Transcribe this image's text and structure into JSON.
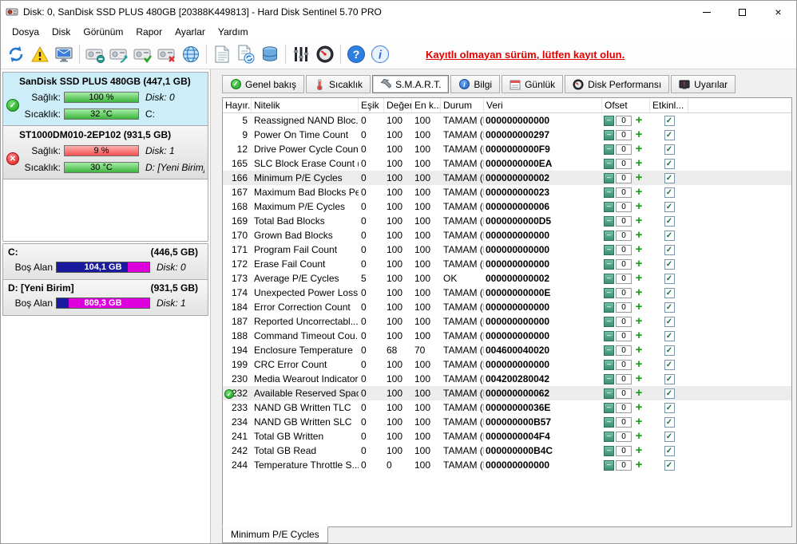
{
  "window": {
    "title": "Disk: 0, SanDisk SSD PLUS 480GB [20388K449813]  -  Hard Disk Sentinel 5.70 PRO"
  },
  "menu": {
    "items": [
      "Dosya",
      "Disk",
      "Görünüm",
      "Rapor",
      "Ayarlar",
      "Yardım"
    ]
  },
  "toolbar": {
    "register_link": "Kayıtlı olmayan sürüm, lütfen kayıt olun."
  },
  "sidebar": {
    "disks": [
      {
        "name": "SanDisk SSD PLUS 480GB",
        "size": "(447,1 GB)",
        "health_label": "Sağlık:",
        "health_value": "100 %",
        "health_pct": 100,
        "disk_no": "Disk: 0",
        "temp_label": "Sıcaklık:",
        "temp_value": "32 °C",
        "drive_letter": "C:"
      },
      {
        "name": "ST1000DM010-2EP102",
        "size": "(931,5 GB)",
        "health_label": "Sağlık:",
        "health_value": "9 %",
        "health_pct": 9,
        "disk_no": "Disk: 1",
        "temp_label": "Sıcaklık:",
        "temp_value": "30 °C",
        "drive_letter": "D: [Yeni Birim]"
      }
    ],
    "partitions": [
      {
        "name": "C:",
        "size": "(446,5 GB)",
        "free_label": "Boş Alan",
        "free_value": "104,1 GB",
        "free_pct": 23,
        "disk_no": "Disk: 0"
      },
      {
        "name": "D: [Yeni Birim]",
        "size": "(931,5 GB)",
        "free_label": "Boş Alan",
        "free_value": "809,3 GB",
        "free_pct": 87,
        "disk_no": "Disk: 1"
      }
    ]
  },
  "tabs": [
    {
      "label": "Genel bakış"
    },
    {
      "label": "Sıcaklık"
    },
    {
      "label": "S.M.A.R.T."
    },
    {
      "label": "Bilgi"
    },
    {
      "label": "Günlük"
    },
    {
      "label": "Disk Performansı"
    },
    {
      "label": "Uyarılar"
    }
  ],
  "smart_table": {
    "headers": [
      "Hayır.",
      "Nitelik",
      "Eşik",
      "Değer",
      "En k...",
      "Durum",
      "Veri",
      "Ofset",
      "Etkinl..."
    ],
    "rows": [
      {
        "id": "5",
        "attribute": "Reassigned NAND Bloc...",
        "threshold": "0",
        "value": "100",
        "worst": "100",
        "status": "TAMAM (H...",
        "data": "000000000000",
        "offset": "0",
        "enabled": true,
        "selected": false,
        "ok_icon": false
      },
      {
        "id": "9",
        "attribute": "Power On Time Count",
        "threshold": "0",
        "value": "100",
        "worst": "100",
        "status": "TAMAM (H...",
        "data": "000000000297",
        "offset": "0",
        "enabled": true,
        "selected": false,
        "ok_icon": false
      },
      {
        "id": "12",
        "attribute": "Drive Power Cycle Count",
        "threshold": "0",
        "value": "100",
        "worst": "100",
        "status": "TAMAM (H...",
        "data": "0000000000F9",
        "offset": "0",
        "enabled": true,
        "selected": false,
        "ok_icon": false
      },
      {
        "id": "165",
        "attribute": "SLC Block Erase Count (...",
        "threshold": "0",
        "value": "100",
        "worst": "100",
        "status": "TAMAM (H...",
        "data": "0000000000EA",
        "offset": "0",
        "enabled": true,
        "selected": false,
        "ok_icon": false
      },
      {
        "id": "166",
        "attribute": "Minimum P/E Cycles",
        "threshold": "0",
        "value": "100",
        "worst": "100",
        "status": "TAMAM (H...",
        "data": "000000000002",
        "offset": "0",
        "enabled": true,
        "selected": true,
        "ok_icon": false
      },
      {
        "id": "167",
        "attribute": "Maximum Bad Blocks Pe...",
        "threshold": "0",
        "value": "100",
        "worst": "100",
        "status": "TAMAM (H...",
        "data": "000000000023",
        "offset": "0",
        "enabled": true,
        "selected": false,
        "ok_icon": false
      },
      {
        "id": "168",
        "attribute": "Maximum P/E Cycles",
        "threshold": "0",
        "value": "100",
        "worst": "100",
        "status": "TAMAM (H...",
        "data": "000000000006",
        "offset": "0",
        "enabled": true,
        "selected": false,
        "ok_icon": false
      },
      {
        "id": "169",
        "attribute": "Total Bad Blocks",
        "threshold": "0",
        "value": "100",
        "worst": "100",
        "status": "TAMAM (H...",
        "data": "0000000000D5",
        "offset": "0",
        "enabled": true,
        "selected": false,
        "ok_icon": false
      },
      {
        "id": "170",
        "attribute": "Grown Bad Blocks",
        "threshold": "0",
        "value": "100",
        "worst": "100",
        "status": "TAMAM (H...",
        "data": "000000000000",
        "offset": "0",
        "enabled": true,
        "selected": false,
        "ok_icon": false
      },
      {
        "id": "171",
        "attribute": "Program Fail Count",
        "threshold": "0",
        "value": "100",
        "worst": "100",
        "status": "TAMAM (H...",
        "data": "000000000000",
        "offset": "0",
        "enabled": true,
        "selected": false,
        "ok_icon": false
      },
      {
        "id": "172",
        "attribute": "Erase Fail Count",
        "threshold": "0",
        "value": "100",
        "worst": "100",
        "status": "TAMAM (H...",
        "data": "000000000000",
        "offset": "0",
        "enabled": true,
        "selected": false,
        "ok_icon": false
      },
      {
        "id": "173",
        "attribute": "Average P/E Cycles",
        "threshold": "5",
        "value": "100",
        "worst": "100",
        "status": "OK",
        "data": "000000000002",
        "offset": "0",
        "enabled": true,
        "selected": false,
        "ok_icon": false
      },
      {
        "id": "174",
        "attribute": "Unexpected Power Loss...",
        "threshold": "0",
        "value": "100",
        "worst": "100",
        "status": "TAMAM (H...",
        "data": "00000000000E",
        "offset": "0",
        "enabled": true,
        "selected": false,
        "ok_icon": false
      },
      {
        "id": "184",
        "attribute": "Error Correction Count",
        "threshold": "0",
        "value": "100",
        "worst": "100",
        "status": "TAMAM (H...",
        "data": "000000000000",
        "offset": "0",
        "enabled": true,
        "selected": false,
        "ok_icon": false
      },
      {
        "id": "187",
        "attribute": "Reported Uncorrectabl...",
        "threshold": "0",
        "value": "100",
        "worst": "100",
        "status": "TAMAM (H...",
        "data": "000000000000",
        "offset": "0",
        "enabled": true,
        "selected": false,
        "ok_icon": false
      },
      {
        "id": "188",
        "attribute": "Command Timeout Cou...",
        "threshold": "0",
        "value": "100",
        "worst": "100",
        "status": "TAMAM (H...",
        "data": "000000000000",
        "offset": "0",
        "enabled": true,
        "selected": false,
        "ok_icon": false
      },
      {
        "id": "194",
        "attribute": "Enclosure Temperature",
        "threshold": "0",
        "value": "68",
        "worst": "70",
        "status": "TAMAM (H...",
        "data": "004600040020",
        "offset": "0",
        "enabled": true,
        "selected": false,
        "ok_icon": false
      },
      {
        "id": "199",
        "attribute": "CRC Error Count",
        "threshold": "0",
        "value": "100",
        "worst": "100",
        "status": "TAMAM (H...",
        "data": "000000000000",
        "offset": "0",
        "enabled": true,
        "selected": false,
        "ok_icon": false
      },
      {
        "id": "230",
        "attribute": "Media Wearout Indicator",
        "threshold": "0",
        "value": "100",
        "worst": "100",
        "status": "TAMAM (H...",
        "data": "004200280042",
        "offset": "0",
        "enabled": true,
        "selected": false,
        "ok_icon": false
      },
      {
        "id": "232",
        "attribute": "Available Reserved Space",
        "threshold": "0",
        "value": "100",
        "worst": "100",
        "status": "TAMAM (H...",
        "data": "000000000062",
        "offset": "0",
        "enabled": true,
        "selected": true,
        "ok_icon": true
      },
      {
        "id": "233",
        "attribute": "NAND GB Written TLC",
        "threshold": "0",
        "value": "100",
        "worst": "100",
        "status": "TAMAM (H...",
        "data": "00000000036E",
        "offset": "0",
        "enabled": true,
        "selected": false,
        "ok_icon": false
      },
      {
        "id": "234",
        "attribute": "NAND GB Written SLC",
        "threshold": "0",
        "value": "100",
        "worst": "100",
        "status": "TAMAM (H...",
        "data": "000000000B57",
        "offset": "0",
        "enabled": true,
        "selected": false,
        "ok_icon": false
      },
      {
        "id": "241",
        "attribute": "Total GB Written",
        "threshold": "0",
        "value": "100",
        "worst": "100",
        "status": "TAMAM (H...",
        "data": "0000000004F4",
        "offset": "0",
        "enabled": true,
        "selected": false,
        "ok_icon": false
      },
      {
        "id": "242",
        "attribute": "Total GB Read",
        "threshold": "0",
        "value": "100",
        "worst": "100",
        "status": "TAMAM (H...",
        "data": "000000000B4C",
        "offset": "0",
        "enabled": true,
        "selected": false,
        "ok_icon": false
      },
      {
        "id": "244",
        "attribute": "Temperature Throttle S...",
        "threshold": "0",
        "value": "0",
        "worst": "100",
        "status": "TAMAM (H...",
        "data": "000000000000",
        "offset": "0",
        "enabled": true,
        "selected": false,
        "ok_icon": false
      }
    ]
  },
  "bottom_tab": {
    "label": "Minimum P/E Cycles"
  }
}
